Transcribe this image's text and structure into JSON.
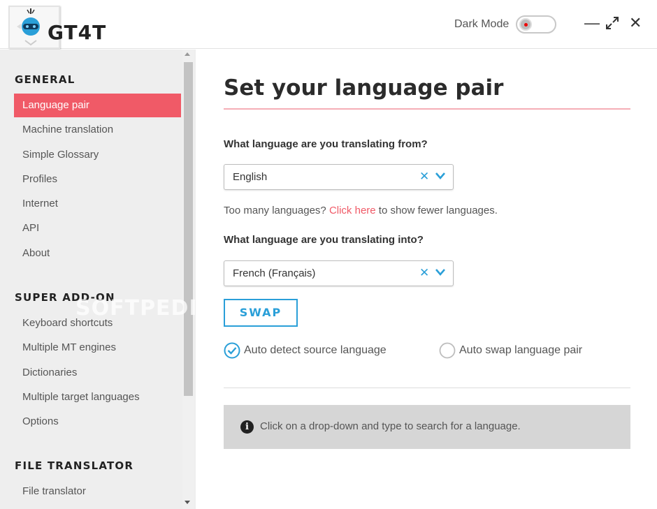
{
  "app": {
    "title": "GT4T",
    "dark_mode_label": "Dark Mode",
    "dark_mode_on": false,
    "window_controls": {
      "minimize": "—",
      "maximize": "⤢",
      "close": "✕"
    }
  },
  "sidebar": {
    "sections": [
      {
        "title": "GENERAL",
        "items": [
          {
            "label": "Language pair",
            "active": true
          },
          {
            "label": "Machine translation"
          },
          {
            "label": "Simple Glossary"
          },
          {
            "label": "Profiles"
          },
          {
            "label": "Internet"
          },
          {
            "label": "API"
          },
          {
            "label": "About"
          }
        ]
      },
      {
        "title": "SUPER ADD-ON",
        "items": [
          {
            "label": "Keyboard shortcuts"
          },
          {
            "label": "Multiple MT engines"
          },
          {
            "label": "Dictionaries"
          },
          {
            "label": "Multiple target languages"
          },
          {
            "label": "Options"
          }
        ]
      },
      {
        "title": "FILE TRANSLATOR",
        "items": [
          {
            "label": "File translator"
          }
        ]
      }
    ],
    "watermark": "SOFTPEDIA"
  },
  "main": {
    "title": "Set your language pair",
    "from": {
      "question": "What language are you translating from?",
      "value": "English",
      "clear": "✕"
    },
    "hint": {
      "before": "Too many languages? ",
      "link": "Click here",
      "after": " to show fewer languages."
    },
    "into": {
      "question": "What language are you translating into?",
      "value": "French (Français)",
      "clear": "✕"
    },
    "swap_label": "SWAP",
    "options": [
      {
        "label": "Auto detect source language",
        "checked": true
      },
      {
        "label": "Auto swap language pair",
        "checked": false
      }
    ],
    "info": {
      "icon": "i",
      "text": "Click on a drop-down and type to search for a language."
    }
  },
  "colors": {
    "accent_red": "#f05a67",
    "accent_blue": "#2a9fd8",
    "title_rule": "#f5aeb6",
    "info_bg": "#d6d6d6"
  }
}
